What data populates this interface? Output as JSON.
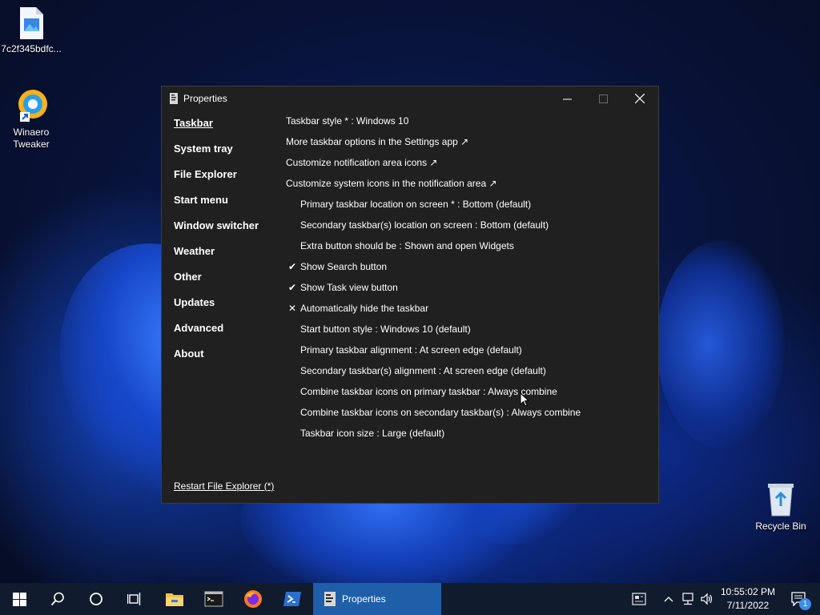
{
  "desktop": {
    "icons": [
      {
        "label": "7c2f345bdfc..."
      },
      {
        "label": "Winaero\nTweaker"
      },
      {
        "label": "Recycle Bin"
      }
    ]
  },
  "window": {
    "title": "Properties",
    "nav": [
      "Taskbar",
      "System tray",
      "File Explorer",
      "Start menu",
      "Window switcher",
      "Weather",
      "Other",
      "Updates",
      "Advanced",
      "About"
    ],
    "active_nav": "Taskbar",
    "options": [
      "Taskbar style * : Windows 10",
      "More taskbar options in the Settings app ↗",
      "Customize notification area icons ↗",
      "Customize system icons in the notification area ↗",
      "Primary taskbar location on screen * : Bottom (default)",
      "Secondary taskbar(s) location on screen : Bottom (default)",
      "Extra button should be : Shown and open Widgets",
      "Show Search button",
      "Show Task view button",
      "Automatically hide the taskbar",
      "Start button style : Windows 10 (default)",
      "Primary taskbar alignment : At screen edge (default)",
      "Secondary taskbar(s) alignment : At screen edge (default)",
      "Combine taskbar icons on primary taskbar : Always combine",
      "Combine taskbar icons on secondary taskbar(s) : Always combine",
      "Taskbar icon size : Large (default)"
    ],
    "checkmark": "✔",
    "crossmark": "✕",
    "restart_link": "Restart File Explorer (*)"
  },
  "taskbar": {
    "active_app_label": "Properties",
    "clock_time": "10:55:02 PM",
    "clock_date": "7/11/2022",
    "notification_count": "1"
  },
  "colors": {
    "window_bg": "#202020",
    "taskbar_bg": "#101b2e",
    "active_app_bg": "#1f5ea8"
  }
}
